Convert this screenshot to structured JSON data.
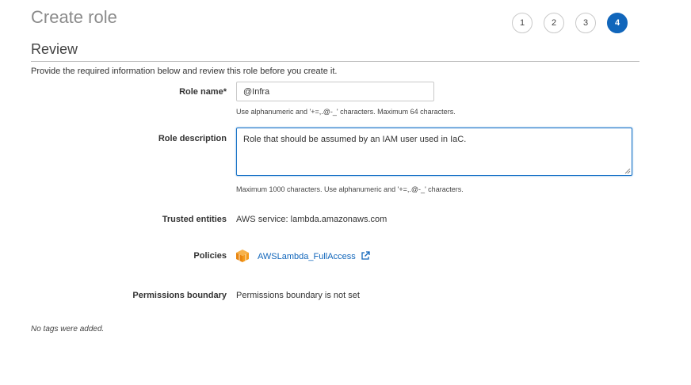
{
  "header": {
    "title": "Create role"
  },
  "steps": [
    "1",
    "2",
    "3",
    "4"
  ],
  "section": {
    "title": "Review",
    "intro": "Provide the required information below and review this role before you create it."
  },
  "form": {
    "role_name": {
      "label": "Role name*",
      "value": "@Infra",
      "hint": "Use alphanumeric and '+=,.@-_' characters. Maximum 64 characters."
    },
    "role_description": {
      "label": "Role description",
      "value": "Role that should be assumed by an IAM user used in IaC.",
      "hint": "Maximum 1000 characters. Use alphanumeric and '+=,.@-_' characters."
    },
    "trusted_entities": {
      "label": "Trusted entities",
      "value": "AWS service: lambda.amazonaws.com"
    },
    "policies": {
      "label": "Policies",
      "link": "AWSLambda_FullAccess",
      "icon": "aws-policy-cube-icon",
      "icon_color": "#f49a1a"
    },
    "permissions_boundary": {
      "label": "Permissions boundary",
      "value": "Permissions boundary is not set"
    }
  },
  "tags_note": "No tags were added.",
  "colors": {
    "accent": "#1166bb",
    "title_gray": "#8b8b8b",
    "policy_orange": "#f49a1a"
  }
}
